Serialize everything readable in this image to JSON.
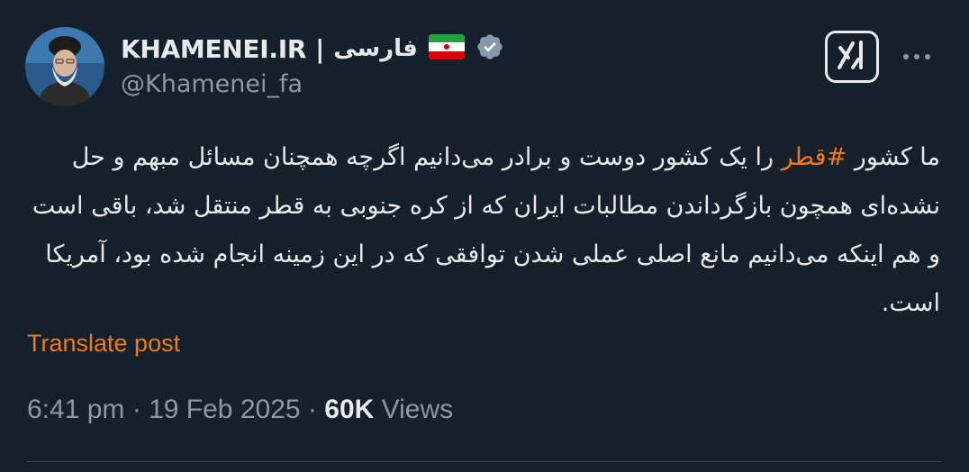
{
  "author": {
    "display_name": "KHAMENEI.IR",
    "separator": "|",
    "language_label": "فارسی",
    "handle": "@Khamenei_fa",
    "verified_icon": "verified-badge-icon",
    "flag_icon": "iran-flag-icon"
  },
  "actions": {
    "grok_icon": "grok-icon",
    "more_icon": "more-dots-icon"
  },
  "tweet": {
    "segment_1": "ما کشور ",
    "hashtag": "#قطر",
    "segment_2": " را یک کشور دوست و برادر می‌دانیم اگرچه همچنان مسائل مبهم و حل نشده‌ای همچون بازگرداندن مطالبات ایران که از کره جنوبی به قطر منتقل شد، باقی است و هم اینکه می‌دانیم مانع اصلی عملی شدن توافقی که در این زمینه انجام شده بود، آمریکا است."
  },
  "translate_label": "Translate post",
  "meta": {
    "time": "6:41 pm",
    "dot1": "·",
    "date": "19 Feb 2025",
    "dot2": "·",
    "views_count": "60K",
    "views_label": "Views"
  },
  "colors": {
    "background": "#15202b",
    "text": "#e7e9ea",
    "muted": "#8b98a5",
    "accent": "#f07a1a",
    "verified": "#829aab"
  }
}
